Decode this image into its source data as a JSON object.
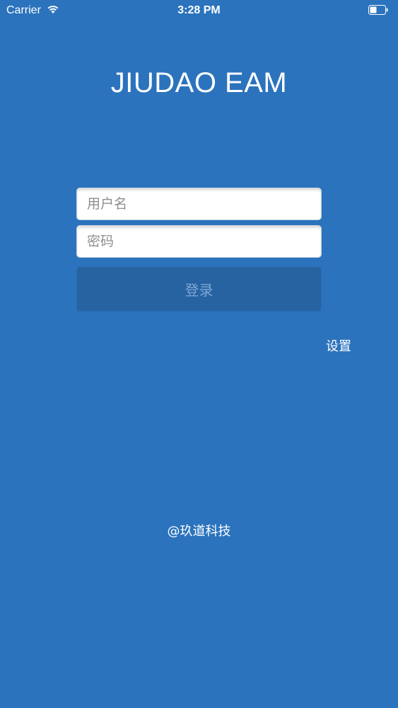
{
  "status_bar": {
    "carrier": "Carrier",
    "time": "3:28 PM",
    "wifi_icon": "wifi-icon",
    "battery_icon": "battery-icon"
  },
  "app": {
    "title": "JIUDAO EAM"
  },
  "login_form": {
    "username_placeholder": "用户名",
    "username_value": "",
    "password_placeholder": "密码",
    "password_value": "",
    "login_label": "登录"
  },
  "settings_label": "设置",
  "footer_text": "@玖道科技",
  "colors": {
    "background": "#2b73bd",
    "button": "#2762a1",
    "button_text": "#7fa8d4"
  }
}
